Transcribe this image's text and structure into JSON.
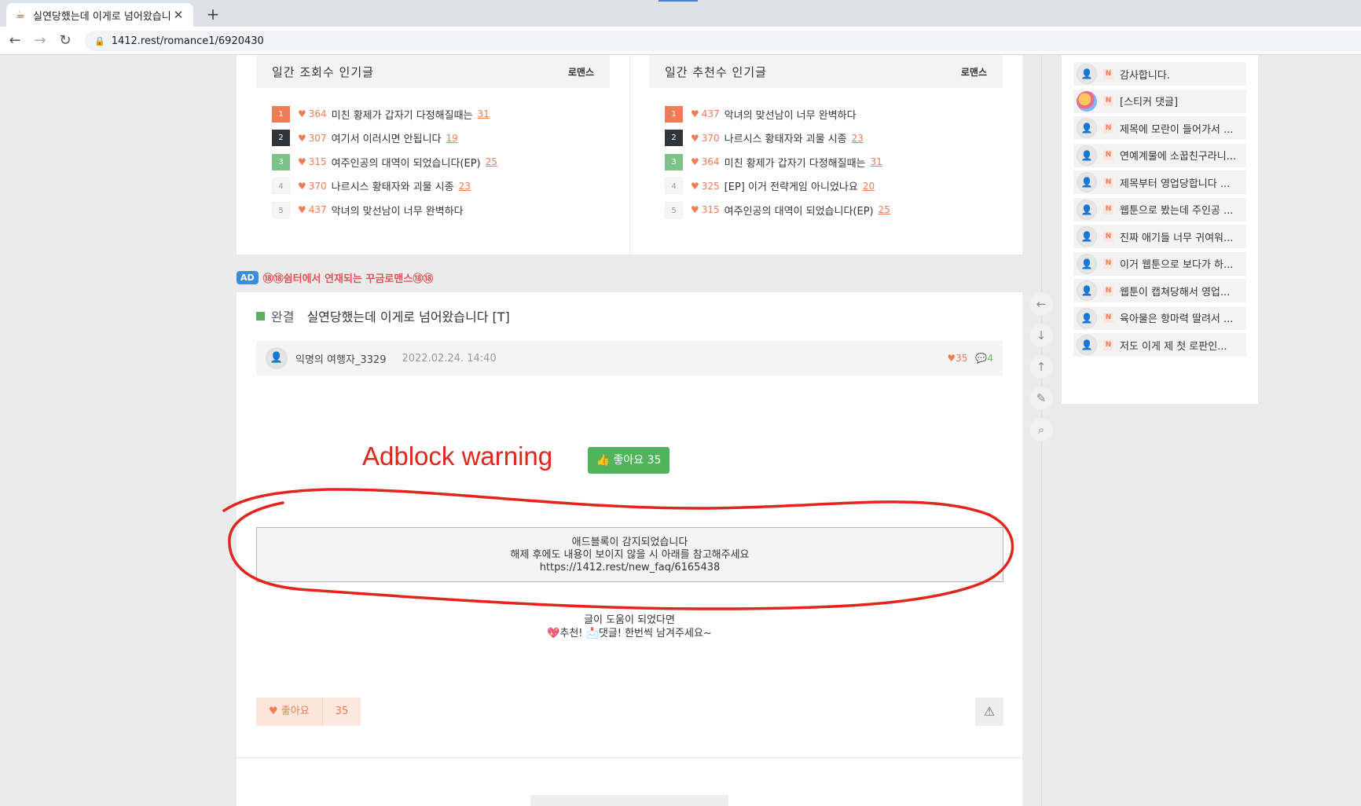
{
  "browser": {
    "tab_title": "실연당했는데 이게로 넘어왔습니",
    "tab_favicon": "coffee-icon",
    "url": "1412.rest/romance1/6920430"
  },
  "popular_daily_views": {
    "title": "일간 조회수 인기글",
    "category": "로맨스",
    "items": [
      {
        "rank": "1",
        "likes": "364",
        "title": "미친 황제가 갑자기 다정해질때는",
        "comments": "31"
      },
      {
        "rank": "2",
        "likes": "307",
        "title": "여기서 이러시면 안됩니다",
        "comments": "19"
      },
      {
        "rank": "3",
        "likes": "315",
        "title": "여주인공의 대역이 되었습니다(EP)",
        "comments": "25"
      },
      {
        "rank": "4",
        "likes": "370",
        "title": "나르시스 황태자와 괴물 시종",
        "comments": "23"
      },
      {
        "rank": "5",
        "likes": "437",
        "title": "악녀의 맞선남이 너무 완벽하다",
        "comments": ""
      }
    ]
  },
  "popular_daily_recommend": {
    "title": "일간 추천수 인기글",
    "category": "로맨스",
    "items": [
      {
        "rank": "1",
        "likes": "437",
        "title": "악녀의 맞선남이 너무 완벽하다",
        "comments": ""
      },
      {
        "rank": "2",
        "likes": "370",
        "title": "나르시스 황태자와 괴물 시종",
        "comments": "23"
      },
      {
        "rank": "3",
        "likes": "364",
        "title": "미친 황제가 갑자기 다정해질때는",
        "comments": "31"
      },
      {
        "rank": "4",
        "likes": "325",
        "title": "[EP] 이거 전략게임 아니었나요",
        "comments": "20"
      },
      {
        "rank": "5",
        "likes": "315",
        "title": "여주인공의 대역이 되었습니다(EP)",
        "comments": "25"
      }
    ]
  },
  "ad": {
    "tag": "AD",
    "text": "⑱⑱쉼터에서 연재되는 꾸금로맨스⑱⑱"
  },
  "article": {
    "status": "완결",
    "title": "실연당했는데 이게로 넘어왔습니다 [T]",
    "author": "익명의 여행자_3329",
    "date": "2022.02.24. 14:40",
    "likes": "35",
    "comments": "4",
    "annotation": "Adblock warning",
    "like_button_label": "👍 좋아요 35",
    "adblock_lines": [
      "애드블록이 감지되었습니다",
      "해제 후에도 내용이 보이지 않을 시 아래를 참고해주세요",
      "https://1412.rest/new_faq/6165438"
    ],
    "helpful_lines": [
      "글이 도움이 되었다면",
      "💖추천! 📩댓글! 한번씩 남겨주세요~"
    ],
    "bottom_like_label": "♥ 좋아요",
    "bottom_like_count": "35"
  },
  "sidebar": {
    "items": [
      {
        "text": "감사합니다.",
        "sticker": false
      },
      {
        "text": "[스티커 댓글]",
        "sticker": true
      },
      {
        "text": "제목에 모란이 들어가서 ...",
        "sticker": false
      },
      {
        "text": "연예계물에 소꿉친구라니...",
        "sticker": false
      },
      {
        "text": "제목부터 영업당합니다 ...",
        "sticker": false
      },
      {
        "text": "웹툰으로 봤는데 주인공 ...",
        "sticker": false
      },
      {
        "text": "진짜 애기들 너무 귀여워...",
        "sticker": false
      },
      {
        "text": "이거 웹툰으로 보다가 하...",
        "sticker": false
      },
      {
        "text": "웹툰이 캡쳐당해서 영업...",
        "sticker": false
      },
      {
        "text": "육아물은 항마력 딸려서 ...",
        "sticker": false
      },
      {
        "text": "저도 이게 제 첫 로판인...",
        "sticker": false
      }
    ],
    "badge": "N"
  },
  "colors": {
    "accent": "#ef7c54",
    "annotation_red": "#e0261d",
    "green_button": "#52b35d"
  }
}
